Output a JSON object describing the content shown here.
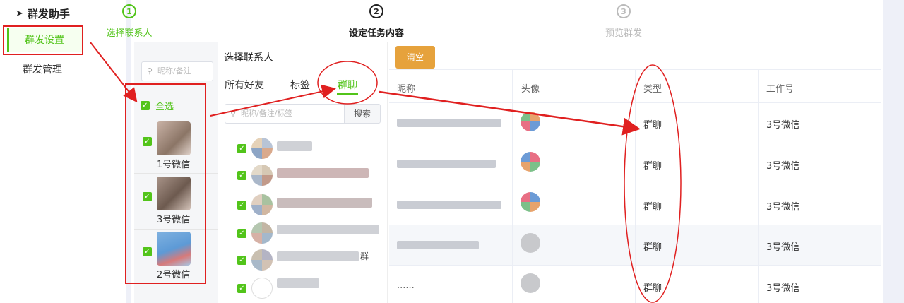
{
  "sidebar": {
    "brand": "群发助手",
    "items": [
      {
        "label": "群发设置"
      },
      {
        "label": "群发管理"
      }
    ]
  },
  "steps": [
    {
      "num": "1",
      "label": "选择联系人"
    },
    {
      "num": "2",
      "label": "设定任务内容"
    },
    {
      "num": "3",
      "label": "预览群发"
    }
  ],
  "accounts": {
    "search_placeholder": "昵称/备注",
    "select_all": "全选",
    "items": [
      {
        "name": "1号微信"
      },
      {
        "name": "3号微信"
      },
      {
        "name": "2号微信"
      }
    ]
  },
  "contacts": {
    "title": "选择联系人",
    "tabs": [
      "所有好友",
      "标签",
      "群聊"
    ],
    "search_placeholder": "昵称/备注/标签",
    "search_button": "搜索",
    "group_suffix": "群"
  },
  "table": {
    "clear_button": "清空",
    "headers": [
      "昵称",
      "头像",
      "类型",
      "工作号"
    ],
    "rows": [
      {
        "type": "群聊",
        "account": "3号微信"
      },
      {
        "type": "群聊",
        "account": "3号微信"
      },
      {
        "type": "群聊",
        "account": "3号微信"
      },
      {
        "type": "群聊",
        "account": "3号微信"
      },
      {
        "type": "群聊",
        "account": "3号微信",
        "nickname": "......"
      }
    ]
  },
  "colors": {
    "accent": "#52c41a",
    "warning": "#e6a23c",
    "annotation": "#e02020"
  }
}
